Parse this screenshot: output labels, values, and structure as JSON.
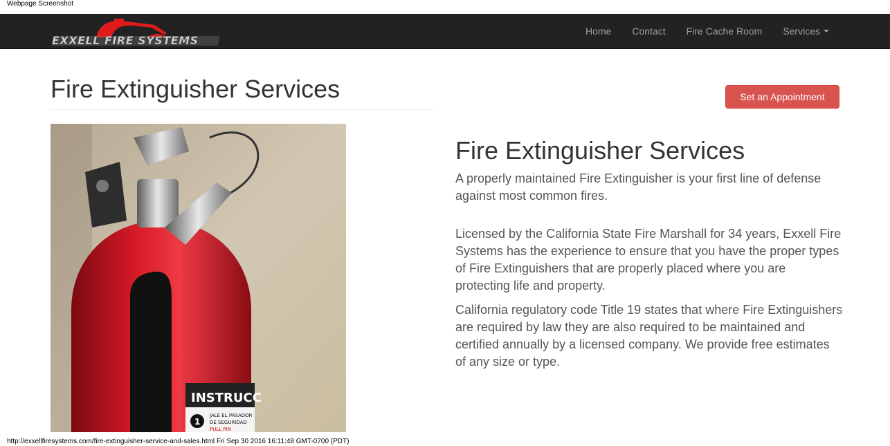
{
  "capture_label": "Webpage Screenshot",
  "navbar": {
    "logo_text": "EXXELL FIRE SYSTEMS",
    "items": [
      {
        "label": "Home"
      },
      {
        "label": "Contact"
      },
      {
        "label": "Fire Cache Room"
      },
      {
        "label": "Services"
      }
    ]
  },
  "page": {
    "title": "Fire Extinguisher Services",
    "appointment_button": "Set an Appointment"
  },
  "photo": {
    "label_text": "INSTRUCC",
    "step_number": "1",
    "step_text_1": "JALE EL PASADOR",
    "step_text_2": "DE SEGURIDAD",
    "step_text_3": "PULL PIN"
  },
  "content": {
    "heading": "Fire Extinguisher Services",
    "lead": "A properly maintained Fire Extinguisher is your first line of defense against most common fires.",
    "paragraph_1": "Licensed by the California State Fire Marshall for 34 years, Exxell Fire Systems has the experience to ensure that you have the proper types of Fire Extinguishers that are properly placed where you are protecting life and property.",
    "paragraph_2": "California regulatory code Title 19 states that where Fire Extinguishers are required by law they are also required to be maintained and certified annually by a licensed company. We provide free estimates of any size or type."
  },
  "footer": {
    "url_text": "http://exxellfiresystems.com/fire-extinguisher-service-and-sales.html Fri Sep 30 2016 16:11:48 GMT-0700 (PDT)"
  },
  "colors": {
    "navbar_bg": "#222222",
    "button_danger": "#d9534f",
    "logo_red": "#e01b1b"
  }
}
